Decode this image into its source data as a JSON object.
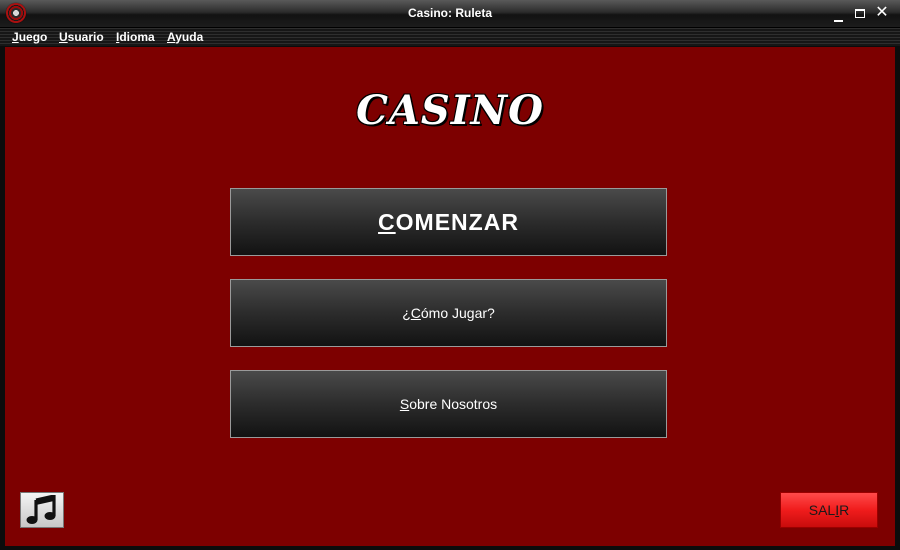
{
  "window": {
    "title": "Casino: Ruleta",
    "app_icon": "roulette-wheel-icon",
    "controls": {
      "minimize_icon": "minimize-icon",
      "maximize_icon": "maximize-icon",
      "close_icon": "close-icon",
      "close_glyph": "✕"
    }
  },
  "menubar": {
    "items": [
      {
        "mnemonic": "J",
        "rest": "uego"
      },
      {
        "mnemonic": "U",
        "rest": "suario"
      },
      {
        "mnemonic": "I",
        "rest": "dioma"
      },
      {
        "mnemonic": "A",
        "rest": "yuda"
      }
    ]
  },
  "main": {
    "brand": "CASINO",
    "start": {
      "mnemonic": "C",
      "rest": "OMENZAR"
    },
    "howto": {
      "prefix": "¿",
      "mnemonic": "C",
      "rest": "ómo Jugar?"
    },
    "about": {
      "mnemonic": "S",
      "rest": "obre Nosotros"
    },
    "music_icon": "music-note-icon",
    "exit": {
      "before": "SAL",
      "mnemonic": "I",
      "after": "R"
    }
  },
  "colors": {
    "background": "#7d0000",
    "exit_button": "#f01c1c",
    "menu_button": "#2c2c2c"
  }
}
